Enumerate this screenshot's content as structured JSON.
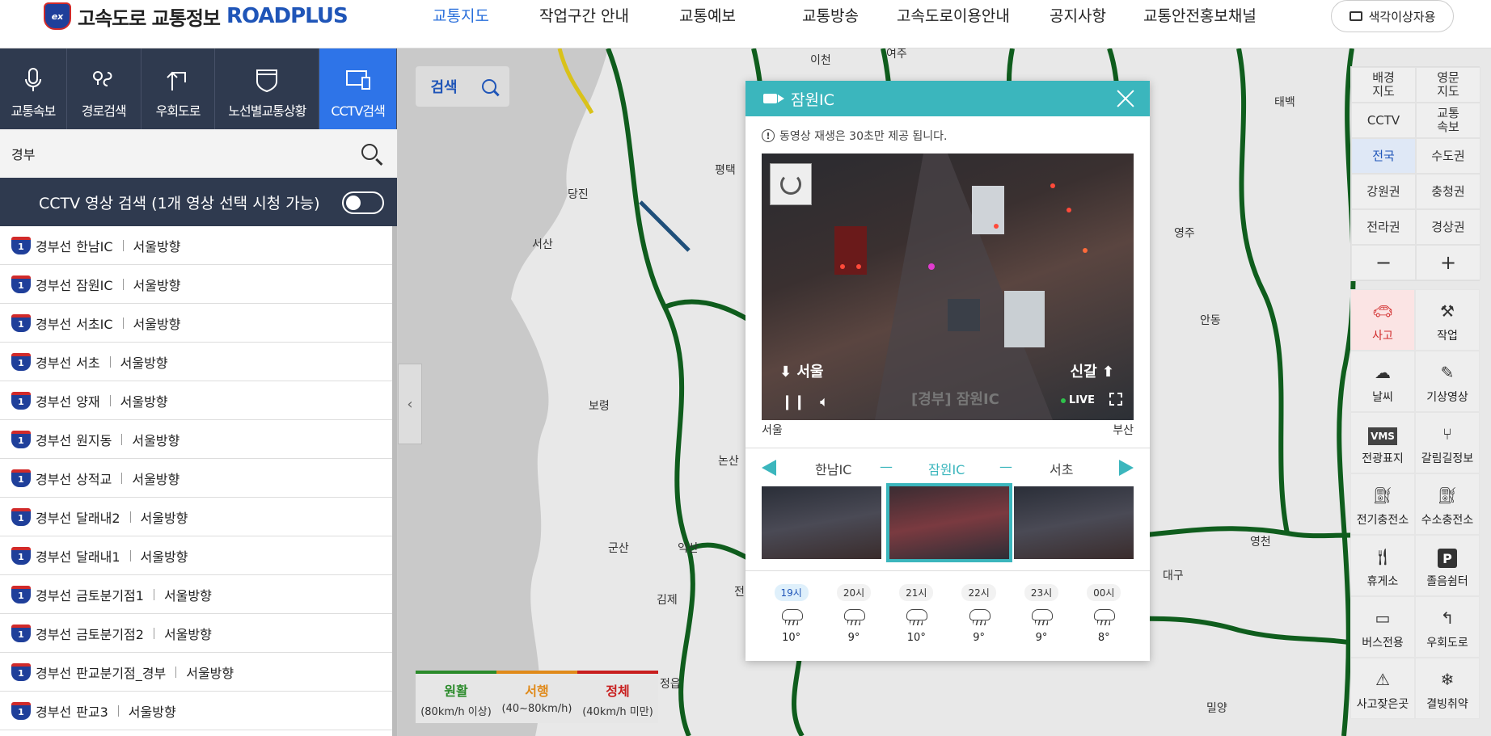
{
  "header": {
    "logo_badge": "ex",
    "logo_text": "고속도로 교통정보",
    "logo_en": "ROADPLUS",
    "nav": [
      "교통지도",
      "작업구간 안내",
      "교통예보",
      "교통방송",
      "고속도로이용안내",
      "공지사항",
      "교통안전홍보채널"
    ],
    "active_nav": "교통지도",
    "color_button": "색각이상자용"
  },
  "left_tabs": [
    {
      "label": "교통속보",
      "icon": "microphone-icon"
    },
    {
      "label": "경로검색",
      "icon": "route-icon"
    },
    {
      "label": "우회도로",
      "icon": "detour-icon"
    },
    {
      "label": "노선별교통상황",
      "icon": "highway-shield-icon"
    },
    {
      "label": "CCTV검색",
      "icon": "monitor-icon",
      "active": true
    }
  ],
  "search": {
    "value": "경부"
  },
  "cctv_bar": {
    "label": "CCTV 영상 검색 (1개 영상 선택 시청 가능)",
    "toggle_on": false
  },
  "list": [
    {
      "route": "1",
      "line": "경부선",
      "name": "한남IC",
      "dir": "서울방향"
    },
    {
      "route": "1",
      "line": "경부선",
      "name": "잠원IC",
      "dir": "서울방향"
    },
    {
      "route": "1",
      "line": "경부선",
      "name": "서초IC",
      "dir": "서울방향"
    },
    {
      "route": "1",
      "line": "경부선",
      "name": "서초",
      "dir": "서울방향"
    },
    {
      "route": "1",
      "line": "경부선",
      "name": "양재",
      "dir": "서울방향"
    },
    {
      "route": "1",
      "line": "경부선",
      "name": "원지동",
      "dir": "서울방향"
    },
    {
      "route": "1",
      "line": "경부선",
      "name": "상적교",
      "dir": "서울방향"
    },
    {
      "route": "1",
      "line": "경부선",
      "name": "달래내2",
      "dir": "서울방향"
    },
    {
      "route": "1",
      "line": "경부선",
      "name": "달래내1",
      "dir": "서울방향"
    },
    {
      "route": "1",
      "line": "경부선",
      "name": "금토분기점1",
      "dir": "서울방향"
    },
    {
      "route": "1",
      "line": "경부선",
      "name": "금토분기점2",
      "dir": "서울방향"
    },
    {
      "route": "1",
      "line": "경부선",
      "name": "판교분기점_경부",
      "dir": "서울방향"
    },
    {
      "route": "1",
      "line": "경부선",
      "name": "판교3",
      "dir": "서울방향"
    }
  ],
  "map": {
    "search_label": "검색",
    "labels": [
      "이천",
      "여주",
      "태백",
      "당진",
      "평택",
      "서산",
      "영주",
      "안동",
      "보령",
      "논산",
      "군산",
      "익산",
      "김제",
      "정읍",
      "대구",
      "영천",
      "밀양",
      "전"
    ],
    "legend": [
      {
        "title": "원활",
        "sub": "(80km/h 이상)",
        "color": "#2a8a2a"
      },
      {
        "title": "서행",
        "sub": "(40~80km/h)",
        "color": "#e08a1a"
      },
      {
        "title": "정체",
        "sub": "(40km/h 미만)",
        "color": "#c81e1e"
      }
    ]
  },
  "right_tools": {
    "grid": [
      "배경\n지도",
      "영문\n지도",
      "CCTV",
      "교통\n속보",
      "전국",
      "수도권",
      "강원권",
      "충청권",
      "전라권",
      "경상권",
      "−",
      "+"
    ],
    "active_grid": "전국",
    "icons": [
      {
        "label": "사고",
        "icon": "accident-icon",
        "active": true
      },
      {
        "label": "작업",
        "icon": "worker-icon"
      },
      {
        "label": "날씨",
        "icon": "weather-icon"
      },
      {
        "label": "기상영상",
        "icon": "weather-video-icon"
      },
      {
        "label": "전광표지",
        "icon": "vms-icon"
      },
      {
        "label": "갈림길정보",
        "icon": "junction-icon"
      },
      {
        "label": "전기충전소",
        "icon": "ev-charger-icon"
      },
      {
        "label": "수소충전소",
        "icon": "hydrogen-icon"
      },
      {
        "label": "휴게소",
        "icon": "rest-area-icon"
      },
      {
        "label": "졸음쉼터",
        "icon": "parking-icon"
      },
      {
        "label": "버스전용",
        "icon": "bus-icon"
      },
      {
        "label": "우회도로",
        "icon": "detour-icon"
      },
      {
        "label": "사고잦은곳",
        "icon": "accident-prone-icon"
      },
      {
        "label": "결빙취약",
        "icon": "icy-road-icon"
      }
    ],
    "vms_text": "VMS",
    "parking_text": "P"
  },
  "popup": {
    "title": "잠원IC",
    "notice": "동영상 재생은 30초만 제공 됩니다.",
    "video": {
      "dir_left": "서울",
      "dir_right": "신갈",
      "cam_title": "[경부] 잠원IC",
      "live": "LIVE"
    },
    "end_left": "서울",
    "end_right": "부산",
    "nav": {
      "prev": "한남IC",
      "current": "잠원IC",
      "next": "서초",
      "dash": "—"
    },
    "weather": [
      {
        "time": "19시",
        "temp": "10°",
        "now": true
      },
      {
        "time": "20시",
        "temp": "9°"
      },
      {
        "time": "21시",
        "temp": "10°"
      },
      {
        "time": "22시",
        "temp": "9°"
      },
      {
        "time": "23시",
        "temp": "9°"
      },
      {
        "time": "00시",
        "temp": "8°"
      }
    ]
  }
}
